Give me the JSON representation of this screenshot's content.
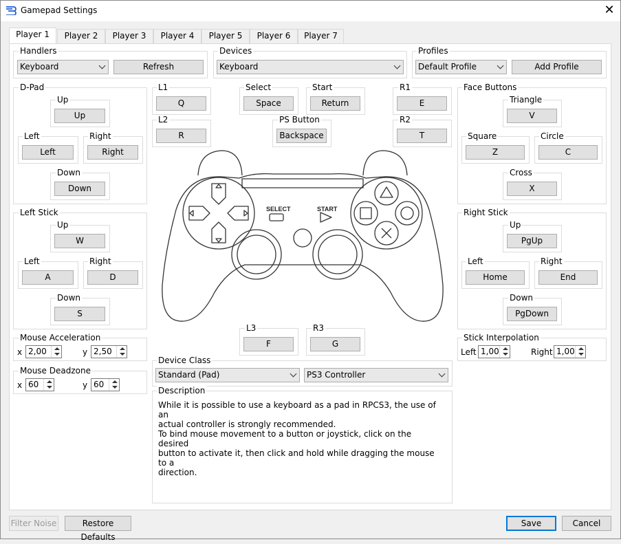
{
  "window": {
    "title": "Gamepad Settings",
    "app_icon": "rpcs3-icon",
    "close_icon": "close-icon"
  },
  "tabs": [
    "Player 1",
    "Player 2",
    "Player 3",
    "Player 4",
    "Player 5",
    "Player 6",
    "Player 7"
  ],
  "handlers": {
    "label": "Handlers",
    "value": "Keyboard",
    "refresh": "Refresh"
  },
  "devices": {
    "label": "Devices",
    "value": "Keyboard"
  },
  "profiles": {
    "label": "Profiles",
    "value": "Default Profile",
    "add": "Add Profile"
  },
  "dpad": {
    "label": "D-Pad",
    "up_label": "Up",
    "up": "Up",
    "left_label": "Left",
    "left": "Left",
    "right_label": "Right",
    "right": "Right",
    "down_label": "Down",
    "down": "Down"
  },
  "left_stick": {
    "label": "Left Stick",
    "up_label": "Up",
    "up": "W",
    "left_label": "Left",
    "left": "A",
    "right_label": "Right",
    "right": "D",
    "down_label": "Down",
    "down": "S"
  },
  "mouse_accel": {
    "label": "Mouse Acceleration",
    "x_label": "x",
    "x": "2,00",
    "y_label": "y",
    "y": "2,50"
  },
  "mouse_deadzone": {
    "label": "Mouse Deadzone",
    "x_label": "x",
    "x": "60",
    "y_label": "y",
    "y": "60"
  },
  "shoulders": {
    "l1_label": "L1",
    "l1": "Q",
    "l2_label": "L2",
    "l2": "R",
    "r1_label": "R1",
    "r1": "E",
    "r2_label": "R2",
    "r2": "T"
  },
  "center": {
    "select_label": "Select",
    "select": "Space",
    "start_label": "Start",
    "start": "Return",
    "ps_label": "PS Button",
    "ps": "Backspace"
  },
  "controller_img": {
    "select_text": "SELECT",
    "start_text": "START"
  },
  "sticks_click": {
    "l3_label": "L3",
    "l3": "F",
    "r3_label": "R3",
    "r3": "G"
  },
  "face": {
    "label": "Face Buttons",
    "triangle_label": "Triangle",
    "triangle": "V",
    "square_label": "Square",
    "square": "Z",
    "circle_label": "Circle",
    "circle": "C",
    "cross_label": "Cross",
    "cross": "X"
  },
  "right_stick": {
    "label": "Right Stick",
    "up_label": "Up",
    "up": "PgUp",
    "left_label": "Left",
    "left": "Home",
    "right_label": "Right",
    "right": "End",
    "down_label": "Down",
    "down": "PgDown"
  },
  "stick_interp": {
    "label": "Stick Interpolation",
    "left_label": "Left",
    "left": "1,00",
    "right_label": "Right",
    "right": "1,00"
  },
  "device_class": {
    "label": "Device Class",
    "value": "Standard (Pad)",
    "model": "PS3 Controller"
  },
  "description": {
    "label": "Description",
    "text": "While it is possible to use a keyboard as a pad in RPCS3, the use of an\nactual controller is strongly recommended.\nTo bind mouse movement to a button or joystick, click on the desired\nbutton to activate it, then click and hold while dragging the mouse to a\ndirection."
  },
  "footer": {
    "filter_noise": "Filter Noise",
    "restore": "Restore Defaults",
    "save": "Save",
    "cancel": "Cancel"
  },
  "colors": {
    "accent": "#0078d7",
    "button_bg": "#e1e1e1",
    "panel_bg": "#ffffff"
  }
}
